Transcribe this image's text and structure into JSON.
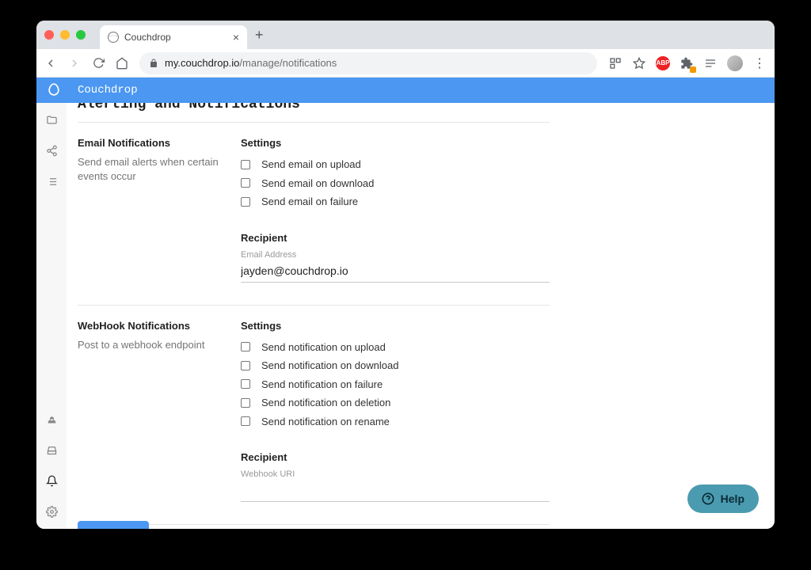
{
  "browser": {
    "tab_title": "Couchdrop",
    "url_host": "my.couchdrop.io",
    "url_path": "/manage/notifications"
  },
  "brand": {
    "name": "Couchdrop"
  },
  "page": {
    "title": "Alerting and Notifications"
  },
  "email_section": {
    "title": "Email Notifications",
    "desc": "Send email alerts when certain events occur",
    "settings_heading": "Settings",
    "opts": [
      "Send email on upload",
      "Send email on download",
      "Send email on failure"
    ],
    "recipient_heading": "Recipient",
    "field_label": "Email Address",
    "field_value": "jayden@couchdrop.io"
  },
  "webhook_section": {
    "title": "WebHook Notifications",
    "desc": "Post to a webhook endpoint",
    "settings_heading": "Settings",
    "opts": [
      "Send notification on upload",
      "Send notification on download",
      "Send notification on failure",
      "Send notification on deletion",
      "Send notification on rename"
    ],
    "recipient_heading": "Recipient",
    "field_label": "Webhook URI",
    "field_value": ""
  },
  "help": {
    "label": "Help"
  }
}
